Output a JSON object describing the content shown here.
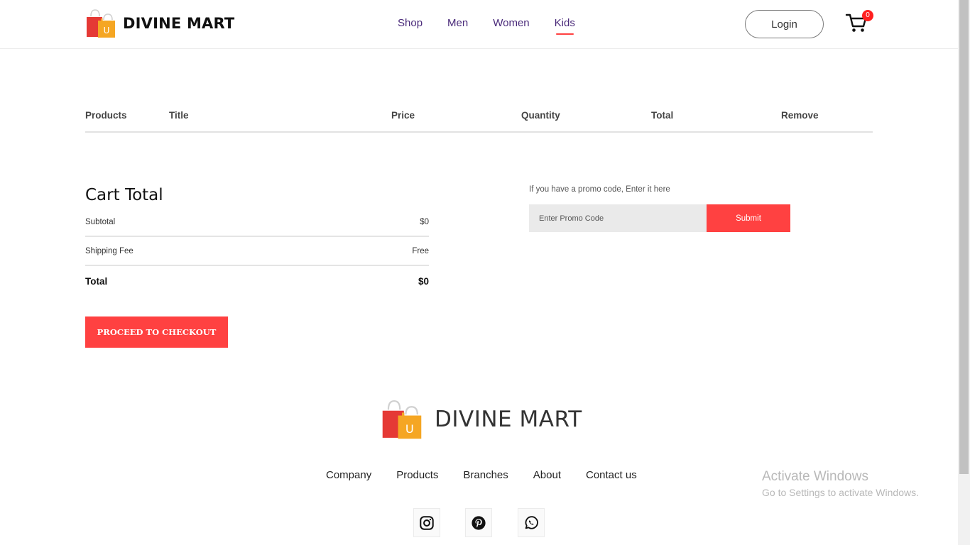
{
  "brand": {
    "name": "DIVINE MART",
    "bag_letter": "U"
  },
  "nav": {
    "items": [
      "Shop",
      "Men",
      "Women",
      "Kids"
    ],
    "active": "Kids"
  },
  "header": {
    "login_label": "Login",
    "cart_count": "0",
    "cart_icon": "cart-icon"
  },
  "table": {
    "headers": [
      "Products",
      "Title",
      "Price",
      "Quantity",
      "Total",
      "Remove"
    ]
  },
  "cart_total": {
    "title": "Cart Total",
    "subtotal_label": "Subtotal",
    "subtotal_value": "$0",
    "shipping_label": "Shipping Fee",
    "shipping_value": "Free",
    "total_label": "Total",
    "total_value": "$0",
    "checkout_label": "PROCEED TO CHECKOUT"
  },
  "promo": {
    "label": "If you have a promo code, Enter it here",
    "placeholder": "Enter Promo Code",
    "submit_label": "Submit"
  },
  "footer": {
    "links": [
      "Company",
      "Products",
      "Branches",
      "About",
      "Contact us"
    ],
    "social": [
      "instagram-icon",
      "pinterest-icon",
      "whatsapp-icon"
    ]
  },
  "watermark": {
    "title": "Activate Windows",
    "subtitle": "Go to Settings to activate Windows."
  },
  "colors": {
    "accent": "#ff4141",
    "nav_text": "#4a2a7a",
    "bag_red": "#e53935",
    "bag_yellow": "#f5a623"
  }
}
